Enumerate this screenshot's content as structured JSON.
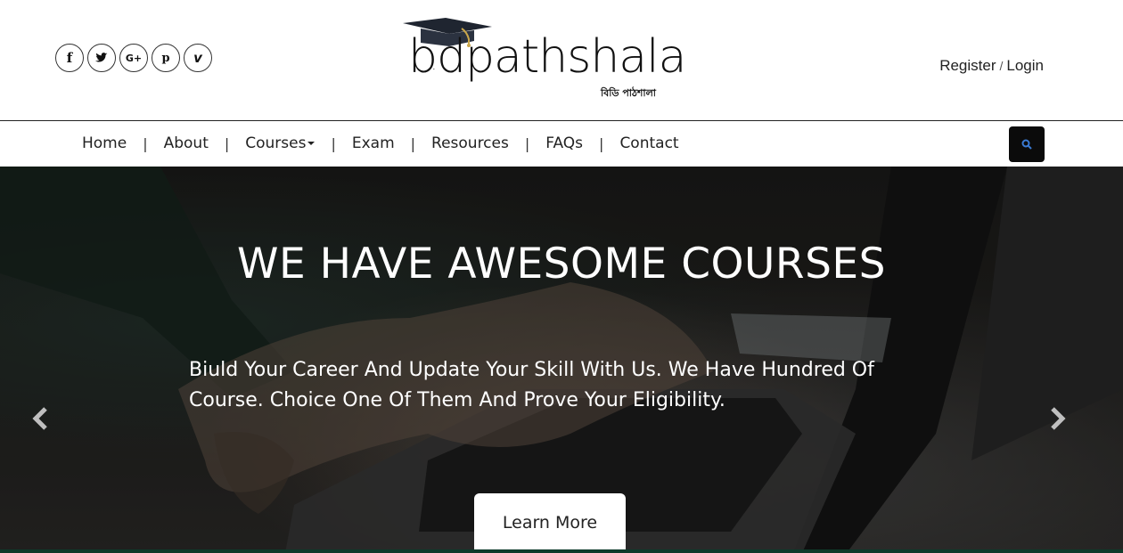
{
  "social": {
    "facebook": "f",
    "twitter": "t",
    "googleplus": "G+",
    "pinterest": "p",
    "vimeo": "v"
  },
  "logo": {
    "text": "bdpathshala",
    "subtitle": "বিডি পাঠশালা"
  },
  "auth": {
    "register": "Register",
    "separator": "/",
    "login": "Login"
  },
  "nav": {
    "items": [
      {
        "label": "Home"
      },
      {
        "label": "About"
      },
      {
        "label": "Courses"
      },
      {
        "label": "Exam"
      },
      {
        "label": "Resources"
      },
      {
        "label": "FAQs"
      },
      {
        "label": "Contact"
      }
    ],
    "separator": "|"
  },
  "hero": {
    "title": "WE HAVE AWESOME COURSES",
    "text": "Biuld Your Career And Update Your Skill With Us. We Have Hundred Of Course. Choice One Of Them And Prove Your Eligibility.",
    "button": "Learn More"
  },
  "colors": {
    "search_button": "#0b0b0b",
    "search_icon": "#3a7bd5",
    "hero_text": "#ffffff"
  },
  "icons": [
    "facebook-icon",
    "twitter-icon",
    "google-plus-icon",
    "pinterest-icon",
    "vimeo-icon",
    "search-icon",
    "chevron-left-icon",
    "chevron-right-icon",
    "graduation-cap-icon"
  ]
}
